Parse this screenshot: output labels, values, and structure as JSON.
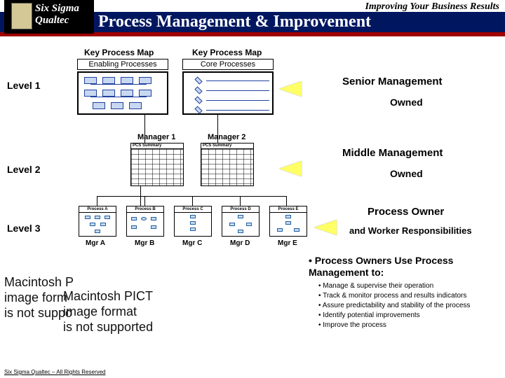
{
  "brand": {
    "line1": "Six Sigma",
    "line2": "Qualtec"
  },
  "tagline": "Improving Your Business Results",
  "title": "Process Management & Improvement",
  "levels": {
    "l1": "Level 1",
    "l2": "Level 2",
    "l3": "Level 3"
  },
  "kpm": {
    "left": "Key Process Map",
    "right": "Key Process Map",
    "sub_left": "Enabling Processes",
    "sub_right": "Core Processes"
  },
  "managers": {
    "m1": "Manager 1",
    "m2": "Manager 2"
  },
  "pcs": "PCS Summary",
  "procs": {
    "a": "Process  A",
    "b": "Process  B",
    "c": "Process  C",
    "d": "Process  D",
    "e": "Process  E"
  },
  "mgrs_bot": {
    "a": "Mgr A",
    "b": "Mgr B",
    "c": "Mgr C",
    "d": "Mgr D",
    "e": "Mgr E"
  },
  "right": {
    "r1": "Senior Management",
    "r1b": "Owned",
    "r2": "Middle Management",
    "r2b": "Owned",
    "r3": "Process Owner",
    "r3b": "and Worker Responsibilities"
  },
  "pict1": "Macintosh P\nimage form\nis not suppo",
  "pict2": "Macintosh PICT\nimage format\nis not supported",
  "bullets": {
    "heading": "• Process Owners Use Process Management to:",
    "items": [
      "Manage & supervise their operation",
      "Track & monitor process and results indicators",
      "Assure predictability and stability of the process",
      "Identify potential improvements",
      "Improve the process"
    ]
  },
  "footer": "Six Sigma Qualtec – All Rights Reserved"
}
